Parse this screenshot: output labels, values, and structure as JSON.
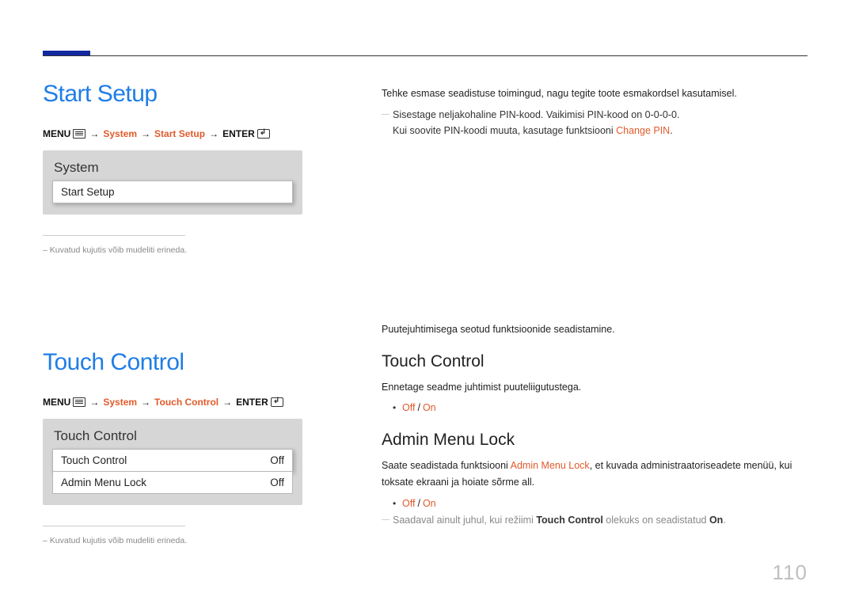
{
  "accent_color": "#e15a2b",
  "link_color": "#1f7de6",
  "start_setup": {
    "title": "Start Setup",
    "crumb": {
      "menu_label": "MENU",
      "system": "System",
      "item": "Start Setup",
      "enter_label": "ENTER"
    },
    "menu_box": {
      "title": "System",
      "item1": "Start Setup"
    },
    "footnote": "Kuvatud kujutis võib mudeliti erineda.",
    "body1": "Tehke esmase seadistuse toimingud, nagu tegite toote esmakordsel kasutamisel.",
    "note1_a": "Sisestage neljakohaline PIN-kood. Vaikimisi PIN-kood on 0-0-0-0.",
    "note1_b_prefix": "Kui soovite PIN-koodi muuta, kasutage funktsiooni ",
    "note1_b_accent": "Change PIN",
    "note1_b_suffix": "."
  },
  "touch_control": {
    "title": "Touch Control",
    "crumb": {
      "menu_label": "MENU",
      "system": "System",
      "item": "Touch Control",
      "enter_label": "ENTER"
    },
    "menu_box": {
      "title": "Touch Control",
      "row1_label": "Touch Control",
      "row1_value": "Off",
      "row2_label": "Admin Menu Lock",
      "row2_value": "Off"
    },
    "footnote": "Kuvatud kujutis võib mudeliti erineda.",
    "intro": "Puutejuhtimisega seotud funktsioonide seadistamine.",
    "tc": {
      "heading": "Touch Control",
      "body": "Ennetage seadme juhtimist puuteliigutustega.",
      "opt_off": "Off",
      "opt_on": "On"
    },
    "aml": {
      "heading": "Admin Menu Lock",
      "body_prefix": "Saate seadistada funktsiooni ",
      "body_accent": "Admin Menu Lock",
      "body_suffix": ", et kuvada administraatoriseadete menüü, kui toksate ekraani ja hoiate sõrme all.",
      "opt_off": "Off",
      "opt_on": "On",
      "note_prefix": "Saadaval ainult juhul, kui režiimi ",
      "note_tc": "Touch Control",
      "note_mid": " olekuks on seadistatud ",
      "note_on": "On",
      "note_suffix": "."
    }
  },
  "page_number": "110"
}
